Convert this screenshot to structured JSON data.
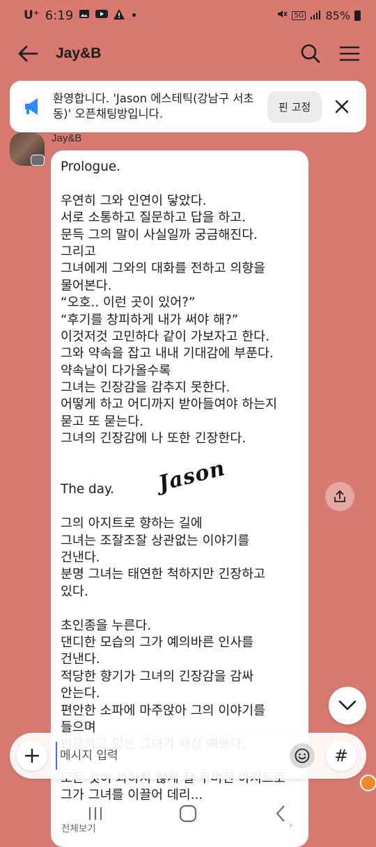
{
  "status_bar": {
    "carrier": "U⁺",
    "time": "6:19",
    "network": "5G",
    "battery": "85%"
  },
  "header": {
    "title": "Jay&B",
    "back_icon": "back-arrow-icon",
    "search_icon": "search-icon",
    "menu_icon": "hamburger-menu-icon"
  },
  "notice": {
    "text": "환영합니다. 'Jason 에스테틱(강남구 서초동)' 오픈채팅방입니다.",
    "pin_label": "핀 고정"
  },
  "message": {
    "sender": "Jay&B",
    "lines": [
      "Prologue.",
      "",
      "우연히 그와 인연이 닿았다.",
      "서로 소통하고 질문하고 답을 하고.",
      "문득 그의 말이 사실일까 궁금해진다.",
      "그리고",
      "그녀에게 그와의 대화를 전하고 의향을",
      "물어본다.",
      "“오호.. 이런 곳이 있어?”",
      "“후기를 창피하게 내가 써야 해?”",
      "이것저것 고민하다 같이 가보자고 한다.",
      "그와 약속을 잡고 내내 기대감에 부푼다.",
      "약속날이 다가올수록",
      "그녀는 긴장감을 감추지 못한다.",
      "어떻게 하고 어디까지 받아들여야 하는지",
      "묻고 또 묻는다.",
      "그녀의 긴장감에 나 또한 긴장한다.",
      "",
      "",
      "The day.",
      "",
      "그의 아지트로 향하는 길에",
      "그녀는 조잘조잘 상관없는 이야기를",
      "건낸다.",
      "분명 그녀는 태연한 척하지만 긴장하고",
      "있다.",
      "",
      "초인종을 누른다.",
      "댄디한 모습의 그가 예의바른 인사를",
      "건낸다.",
      "적당한 향기가 그녀의 긴장감을 감싸",
      "안는다.",
      "편안한 소파에 마주앉아 그의 이야기를",
      "들으며",
      "반응하고 있는 그녀가 새삼 예쁘다.",
      "",
      "모든 것이 과하지 않게 잘 꾸며진 아지트로",
      "그가 그녀를 이끌어 데리..."
    ],
    "watermark": "Jason",
    "view_all": "전체보기"
  },
  "composer": {
    "placeholder": "메시지 입력",
    "hash_label": "#"
  }
}
